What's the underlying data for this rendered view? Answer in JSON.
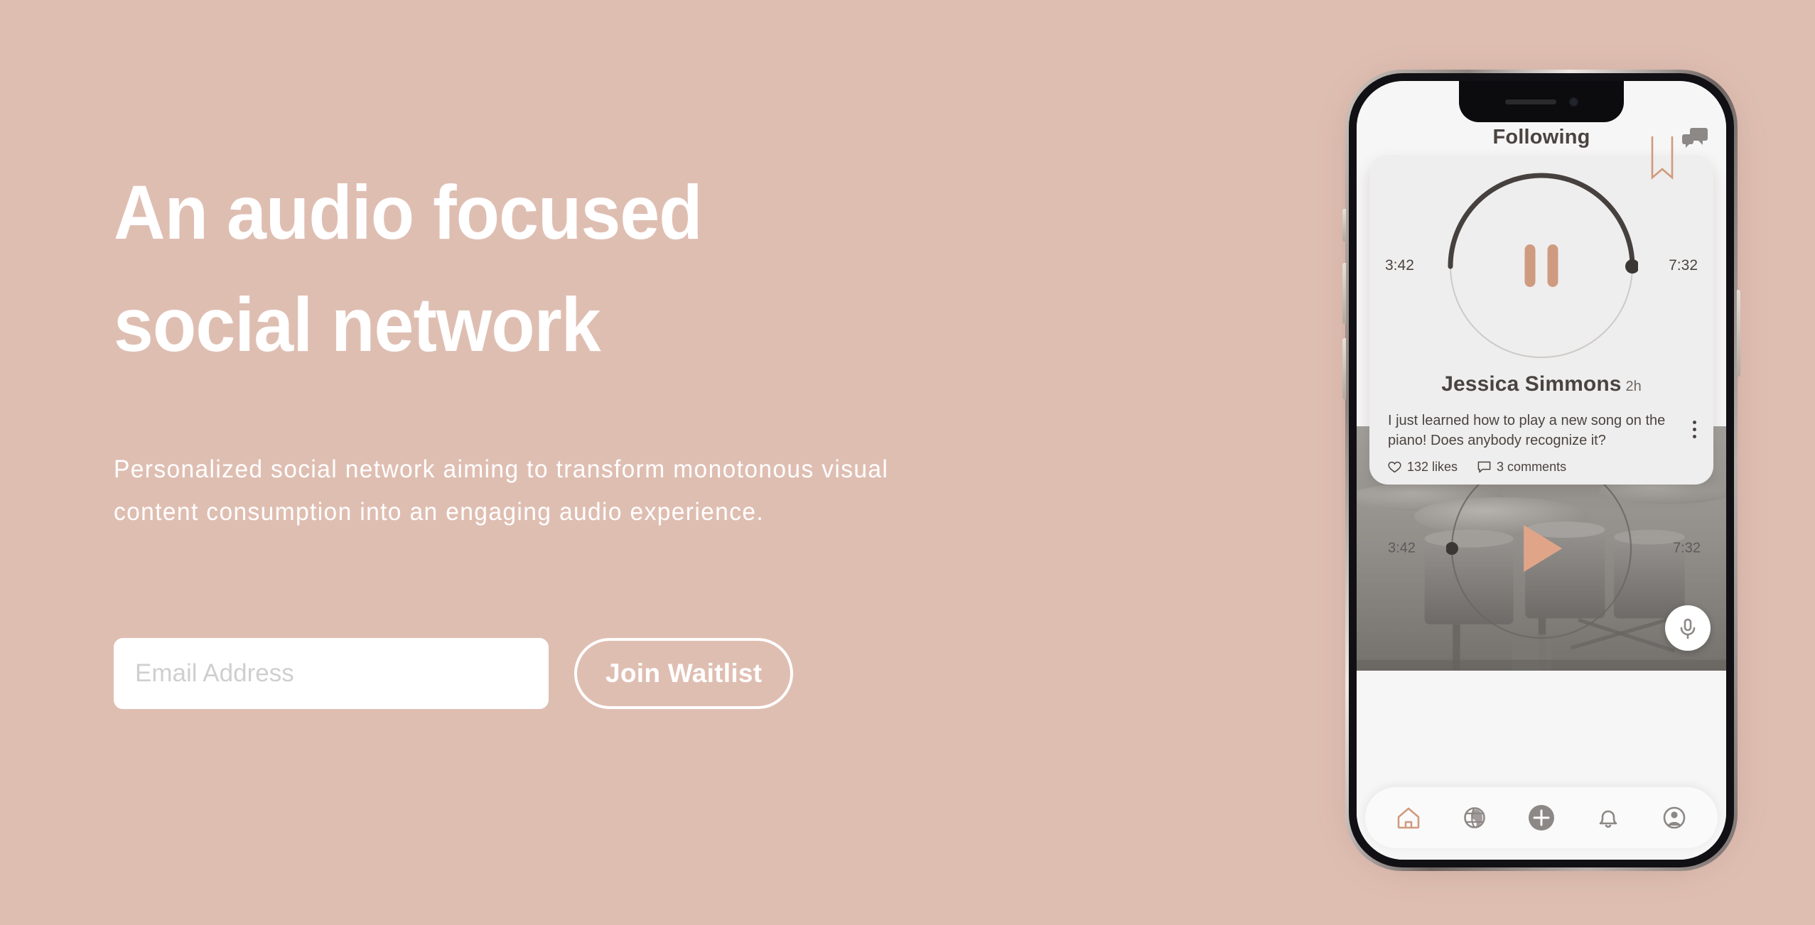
{
  "theme": {
    "background": "#DFBEB2",
    "accent": "#CF9B80",
    "text_on_background": "#FFFFFF",
    "dark_text": "#4A4440",
    "card_background": "#EFEEEE",
    "screen_background": "#F7F6F6"
  },
  "hero": {
    "headline_line_1": "An audio focused",
    "headline_line_2": "social network",
    "subcopy_line_1": "Personalized social network aiming to transform monotonous visual",
    "subcopy_line_2": "content consumption into an engaging audio experience."
  },
  "signup": {
    "email_placeholder": "Email Address",
    "email_value": "",
    "submit_label": "Join Waitlist"
  },
  "phone": {
    "app": {
      "header": {
        "title": "Following",
        "chat_icon": "chat-bubbles-icon"
      },
      "post": {
        "bookmark_icon": "bookmark-icon",
        "player": {
          "state": "playing",
          "control_icon": "pause-icon",
          "elapsed": "3:42",
          "remaining": "7:32",
          "progress_percent": 50
        },
        "author_name": "Jessica Simmons",
        "author_time": "2h",
        "text": "I just learned how to play a new song on the piano! Does anybody recognize it?",
        "likes": "132 likes",
        "comments": "3 comments",
        "like_icon": "heart-icon",
        "comment_icon": "comment-icon",
        "more_icon": "more-vertical-icon"
      },
      "media_post": {
        "image_description": "drum-kit-photo",
        "control_icon": "play-icon",
        "elapsed": "3:42",
        "remaining": "7:32",
        "progress_percent": 0,
        "mic_icon": "microphone-icon"
      },
      "bottom_nav": [
        {
          "name": "home",
          "icon": "home-icon",
          "active": true
        },
        {
          "name": "discover",
          "icon": "globe-icon",
          "active": false
        },
        {
          "name": "create",
          "icon": "plus-circle-icon",
          "active": false
        },
        {
          "name": "notifications",
          "icon": "bell-icon",
          "active": false
        },
        {
          "name": "profile",
          "icon": "user-circle-icon",
          "active": false
        }
      ]
    }
  }
}
